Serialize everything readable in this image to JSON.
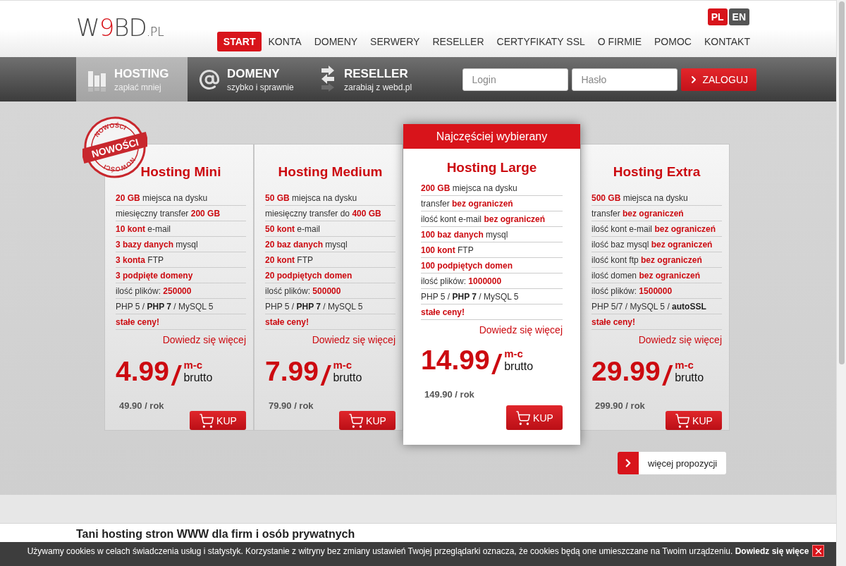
{
  "logo": {
    "lead": "W",
    "accent": "9",
    "main": "BD",
    "suffix": ".PL"
  },
  "languages": [
    {
      "label": "PL",
      "selected": true
    },
    {
      "label": "EN",
      "selected": false
    }
  ],
  "nav": [
    {
      "label": "START",
      "selected": true
    },
    {
      "label": "KONTA",
      "selected": false
    },
    {
      "label": "DOMENY",
      "selected": false
    },
    {
      "label": "SERWERY",
      "selected": false
    },
    {
      "label": "RESELLER",
      "selected": false
    },
    {
      "label": "CERTYFIKATY SSL",
      "selected": false
    },
    {
      "label": "O FIRMIE",
      "selected": false
    },
    {
      "label": "POMOC",
      "selected": false
    },
    {
      "label": "KONTAKT",
      "selected": false
    }
  ],
  "sections": [
    {
      "kind": "bars",
      "title": "HOSTING",
      "subtitle": "zapłać mniej",
      "selected": true
    },
    {
      "kind": "at",
      "title": "DOMENY",
      "subtitle": "szybko i sprawnie",
      "selected": false
    },
    {
      "kind": "swap",
      "title": "RESELLER",
      "subtitle": "zarabiaj z webd.pl",
      "selected": false
    }
  ],
  "login": {
    "login_placeholder": "Login",
    "password_placeholder": "Hasło",
    "button": "ZALOGUJ"
  },
  "plans": [
    {
      "name": "Hosting Mini",
      "featured": false,
      "stamp": {
        "top": "NOWOŚCI",
        "band": "NOWOŚCI",
        "bottom": "NOWOŚCI"
      },
      "features": [
        [
          {
            "t": "20 GB",
            "kind": "red"
          },
          {
            "t": " miejsca na dysku",
            "kind": "plain"
          }
        ],
        [
          {
            "t": "miesięczny transfer ",
            "kind": "plain"
          },
          {
            "t": "200 GB",
            "kind": "red"
          }
        ],
        [
          {
            "t": "10 kont",
            "kind": "red"
          },
          {
            "t": " e-mail",
            "kind": "plain"
          }
        ],
        [
          {
            "t": "3 bazy danych",
            "kind": "red"
          },
          {
            "t": " mysql",
            "kind": "plain"
          }
        ],
        [
          {
            "t": "3 konta",
            "kind": "red"
          },
          {
            "t": " FTP",
            "kind": "plain"
          }
        ],
        [
          {
            "t": "3 podpięte domeny",
            "kind": "red"
          }
        ],
        [
          {
            "t": "ilość plików: ",
            "kind": "plain"
          },
          {
            "t": "250000",
            "kind": "red"
          }
        ],
        [
          {
            "t": "PHP 5 / ",
            "kind": "plain"
          },
          {
            "t": "PHP 7",
            "kind": "dark"
          },
          {
            "t": " / MySQL 5",
            "kind": "plain"
          }
        ],
        [
          {
            "t": "stałe ceny!",
            "kind": "red"
          }
        ]
      ],
      "more": "Dowiedz się więcej",
      "price": "4.99",
      "slash": "/",
      "period": "m-c",
      "tax": "brutto",
      "yearly": "49.90 / rok",
      "buy": "KUP"
    },
    {
      "name": "Hosting Medium",
      "featured": false,
      "features": [
        [
          {
            "t": "50 GB",
            "kind": "red"
          },
          {
            "t": " miejsca na dysku",
            "kind": "plain"
          }
        ],
        [
          {
            "t": "miesięczny transfer do ",
            "kind": "plain"
          },
          {
            "t": "400 GB",
            "kind": "red"
          }
        ],
        [
          {
            "t": "50 kont",
            "kind": "red"
          },
          {
            "t": " e-mail",
            "kind": "plain"
          }
        ],
        [
          {
            "t": "20 baz danych",
            "kind": "red"
          },
          {
            "t": " mysql",
            "kind": "plain"
          }
        ],
        [
          {
            "t": "20 kont",
            "kind": "red"
          },
          {
            "t": " FTP",
            "kind": "plain"
          }
        ],
        [
          {
            "t": "20 podpiętych domen",
            "kind": "red"
          }
        ],
        [
          {
            "t": "ilość plików: ",
            "kind": "plain"
          },
          {
            "t": "500000",
            "kind": "red"
          }
        ],
        [
          {
            "t": "PHP 5 / ",
            "kind": "plain"
          },
          {
            "t": "PHP 7",
            "kind": "dark"
          },
          {
            "t": " / MySQL 5",
            "kind": "plain"
          }
        ],
        [
          {
            "t": "stałe ceny!",
            "kind": "red"
          }
        ]
      ],
      "more": "Dowiedz się więcej",
      "price": "7.99",
      "slash": "/",
      "period": "m-c",
      "tax": "brutto",
      "yearly": "79.90 / rok",
      "buy": "KUP"
    },
    {
      "name": "Hosting Large",
      "featured": true,
      "badge": "Najczęściej wybierany",
      "features": [
        [
          {
            "t": "200 GB",
            "kind": "red"
          },
          {
            "t": " miejsca na dysku",
            "kind": "plain"
          }
        ],
        [
          {
            "t": "transfer ",
            "kind": "plain"
          },
          {
            "t": "bez ograniczeń",
            "kind": "red"
          }
        ],
        [
          {
            "t": "ilość kont e-mail ",
            "kind": "plain"
          },
          {
            "t": "bez ograniczeń",
            "kind": "red"
          }
        ],
        [
          {
            "t": "100 baz danych",
            "kind": "red"
          },
          {
            "t": " mysql",
            "kind": "plain"
          }
        ],
        [
          {
            "t": "100 kont",
            "kind": "red"
          },
          {
            "t": " FTP",
            "kind": "plain"
          }
        ],
        [
          {
            "t": "100 podpiętych domen",
            "kind": "red"
          }
        ],
        [
          {
            "t": "ilość plików: ",
            "kind": "plain"
          },
          {
            "t": "1000000",
            "kind": "red"
          }
        ],
        [
          {
            "t": "PHP 5 / ",
            "kind": "plain"
          },
          {
            "t": "PHP 7",
            "kind": "dark"
          },
          {
            "t": " / MySQL 5",
            "kind": "plain"
          }
        ],
        [
          {
            "t": "stałe ceny!",
            "kind": "red"
          }
        ]
      ],
      "more": "Dowiedz się więcej",
      "price": "14.99",
      "slash": "/",
      "period": "m-c",
      "tax": "brutto",
      "yearly": "149.90 / rok",
      "buy": "KUP"
    },
    {
      "name": "Hosting Extra",
      "featured": false,
      "features": [
        [
          {
            "t": "500 GB",
            "kind": "red"
          },
          {
            "t": " miejsca na dysku",
            "kind": "plain"
          }
        ],
        [
          {
            "t": "transfer ",
            "kind": "plain"
          },
          {
            "t": "bez ograniczeń",
            "kind": "red"
          }
        ],
        [
          {
            "t": "ilość kont e-mail ",
            "kind": "plain"
          },
          {
            "t": "bez ograniczeń",
            "kind": "red"
          }
        ],
        [
          {
            "t": "ilość baz mysql ",
            "kind": "plain"
          },
          {
            "t": "bez ograniczeń",
            "kind": "red"
          }
        ],
        [
          {
            "t": "ilość kont ftp ",
            "kind": "plain"
          },
          {
            "t": "bez ograniczeń",
            "kind": "red"
          }
        ],
        [
          {
            "t": "ilość domen ",
            "kind": "plain"
          },
          {
            "t": "bez ograniczeń",
            "kind": "red"
          }
        ],
        [
          {
            "t": "ilość plików: ",
            "kind": "plain"
          },
          {
            "t": "1500000",
            "kind": "red"
          }
        ],
        [
          {
            "t": "PHP 5/7 / MySQL 5 / ",
            "kind": "plain"
          },
          {
            "t": "autoSSL",
            "kind": "dark"
          }
        ],
        [
          {
            "t": "stałe ceny!",
            "kind": "red"
          }
        ]
      ],
      "more": "Dowiedz się więcej",
      "price": "29.99",
      "slash": "/",
      "period": "m-c",
      "tax": "brutto",
      "yearly": "299.90 / rok",
      "buy": "KUP"
    }
  ],
  "more_offers": "więcej propozycji",
  "article": {
    "heading": "Tani hosting stron WWW dla firm i osób prywatnych"
  },
  "cookie_bar": {
    "text": "Używamy cookies w celach świadczenia usług i statystyk. Korzystanie z witryny bez zmiany ustawień Twojej przeglądarki oznacza, że cookies będą one umieszczane na Twoim urządzeniu.",
    "link": "Dowiedz się więce"
  }
}
